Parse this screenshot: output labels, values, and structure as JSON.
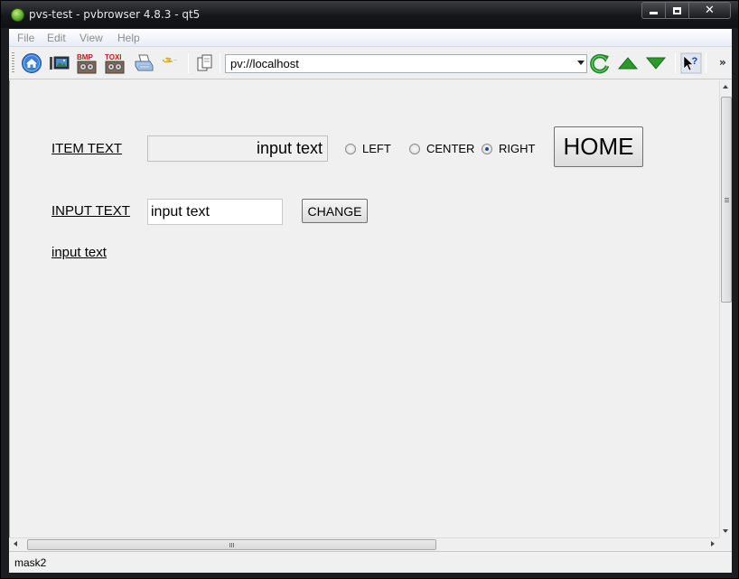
{
  "window": {
    "title": "pvs-test - pvbrowser 4.8.3 - qt5",
    "controls": {
      "minimize": "—",
      "maximize": "□",
      "close": "✕"
    }
  },
  "menu": {
    "items": [
      "File",
      "Edit",
      "View",
      "Help"
    ]
  },
  "toolbar": {
    "icons": [
      "home-icon",
      "screen-icon",
      "bmp-screenshot-icon",
      "bmp-toxic-icon",
      "printer-icon",
      "wrench-icon",
      "copy-icon",
      "reload-icon",
      "arrow-up-icon",
      "arrow-down-icon",
      "whats-this-icon"
    ],
    "url": "pv://localhost",
    "overflow": "»"
  },
  "content": {
    "item_text_label": "ITEM TEXT",
    "item_text_value": "input text",
    "radios": [
      {
        "label": "LEFT",
        "checked": false
      },
      {
        "label": "CENTER",
        "checked": false
      },
      {
        "label": "RIGHT",
        "checked": true
      }
    ],
    "home_button": "HOME",
    "input_text_label": "INPUT TEXT",
    "input_text_value": "input text",
    "change_button": "CHANGE",
    "echo_label": "input text"
  },
  "status": {
    "text": "mask2"
  },
  "colors": {
    "background": "#f0f0f0",
    "accent_green": "#2e9a2e",
    "radio_dot": "#1d4f8a"
  }
}
